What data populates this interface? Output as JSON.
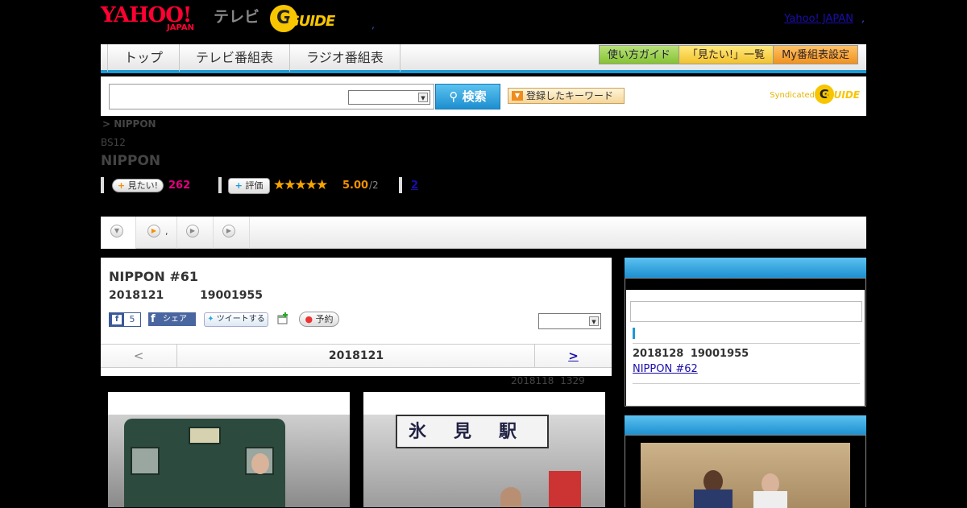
{
  "header": {
    "yahoo_logo": "YAHOO!",
    "japan_logo": "JAPAN",
    "tv_label": "テレビ",
    "gguide_g": "G",
    "gguide_text": "GUIDE",
    "dot": ",",
    "yahoo_japan_link": "Yahoo! JAPAN",
    "dot2": ","
  },
  "nav": {
    "tabs": [
      "トップ",
      "テレビ番組表",
      "ラジオ番組表"
    ],
    "right_buttons": [
      "使い方ガイド",
      "「見たい!」一覧",
      "My番組表設定"
    ]
  },
  "search": {
    "input_value": "",
    "select_value": "",
    "search_button": "検索",
    "keyword_button": "登録したキーワード",
    "syndicated_label": "Syndicated",
    "syndicated_g": "G",
    "syndicated_guide": "GUIDE"
  },
  "breadcrumb": "> NIPPON",
  "station": "BS12",
  "program_title": "NIPPON",
  "stats": {
    "mitai_label": "見たい!",
    "mitai_count": "262",
    "hyoka_label": "評価",
    "stars": "★★★★★",
    "score": "5.00",
    "score_den": "/2",
    "review_count": "2"
  },
  "subtabs": {
    "dot": ","
  },
  "episode": {
    "title": "NIPPON #61",
    "date": "2018121 19001955",
    "fb_like_count": "5",
    "fb_share": "シェア",
    "tweet": "ツイートする",
    "yoyaku": "予約",
    "select_value": "",
    "nav_prev": "<",
    "nav_current": "2018121",
    "nav_next": ">",
    "update_note": "2018118 1329"
  },
  "photos": {
    "station_sign": "氷見駅"
  },
  "right_panel": {
    "next_date": "2018128 19001955",
    "next_link": "NIPPON #62"
  },
  "colors": {
    "accent_blue": "#1a9ad6",
    "pink": "#e4007f",
    "star_orange": "#f7a400",
    "link": "#1a0dab"
  }
}
